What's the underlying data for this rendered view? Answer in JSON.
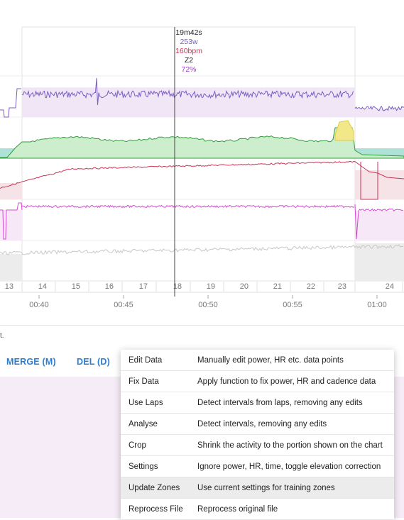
{
  "chart_data": {
    "type": "line",
    "lap_ticks": [
      "13",
      "14",
      "15",
      "16",
      "17",
      "18",
      "19",
      "20",
      "21",
      "22",
      "23",
      "24"
    ],
    "time_ticks": [
      "00:40",
      "00:45",
      "00:50",
      "00:55",
      "01:00"
    ],
    "series": [
      {
        "metric": "power",
        "color": "#7b5cc4",
        "fill": "#f1e6f6",
        "level": 0.72
      },
      {
        "metric": "heart_rate",
        "color": "#cc3355",
        "fill": "#f6e3e7"
      },
      {
        "metric": "cadence",
        "color": "#d54bd0",
        "fill": "#f7e8f7"
      },
      {
        "metric": "zones",
        "color": "#2f9e3a",
        "fill": "#cdeecd"
      },
      {
        "metric": "speed",
        "color": "#c8c8c8",
        "fill": "#ececec"
      }
    ],
    "cursor": {
      "time": "19m42s",
      "power": "253w",
      "hr": "160bpm",
      "zone": "Z2",
      "pct": "72%"
    }
  },
  "tooltip": {
    "time": "19m42s",
    "power": "253w",
    "hr": "160bpm",
    "zone": "Z2",
    "pct": "72%",
    "colors": {
      "time": "#222222",
      "power": "#7b5cc4",
      "hr": "#cc3355",
      "zone": "#222222",
      "pct": "#9b3fc9"
    }
  },
  "footer_note": "t.",
  "actions": {
    "merge": "MERGE (M)",
    "del": "DEL (D)",
    "accent": "#2a7fd4"
  },
  "menu": {
    "items": [
      {
        "label": "Edit Data",
        "desc": "Manually edit power, HR etc. data points"
      },
      {
        "label": "Fix Data",
        "desc": "Apply function to fix power, HR and cadence data"
      },
      {
        "label": "Use Laps",
        "desc": "Detect intervals from laps, removing any edits"
      },
      {
        "label": "Analyse",
        "desc": "Detect intervals, removing any edits"
      },
      {
        "label": "Crop",
        "desc": "Shrink the activity to the portion shown on the chart"
      },
      {
        "label": "Settings",
        "desc": "Ignore power, HR, time, toggle elevation correction"
      },
      {
        "label": "Update Zones",
        "desc": "Use current settings for training zones",
        "highlighted": true
      },
      {
        "label": "Reprocess File",
        "desc": "Reprocess original file"
      }
    ]
  }
}
